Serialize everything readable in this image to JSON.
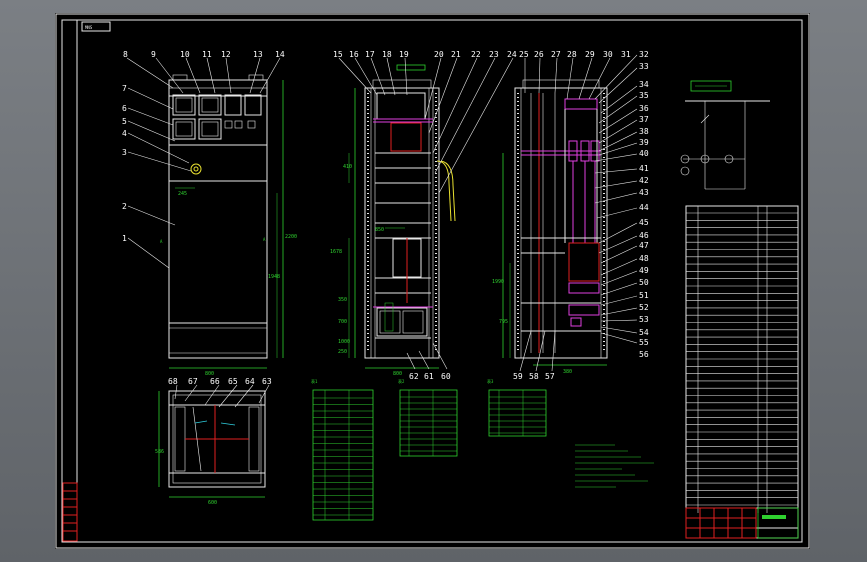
{
  "sheet": {
    "frame_tag": "MNS"
  },
  "callouts_front": [
    "8",
    "9",
    "10",
    "11",
    "12",
    "13",
    "14",
    "7",
    "6",
    "5",
    "4",
    "3",
    "2",
    "1"
  ],
  "callouts_side": [
    "15",
    "16",
    "17",
    "18",
    "19",
    "20",
    "21",
    "22",
    "23",
    "24"
  ],
  "callouts_rear": [
    "25",
    "26",
    "27",
    "28",
    "29",
    "30",
    "31",
    "32",
    "33",
    "34",
    "35",
    "36",
    "37",
    "38",
    "39",
    "40",
    "41",
    "42",
    "43",
    "44",
    "45",
    "46",
    "47",
    "48",
    "49",
    "50",
    "51",
    "52",
    "53",
    "54",
    "55",
    "56"
  ],
  "callouts_bottom_side": [
    "62",
    "61",
    "60"
  ],
  "callouts_bottom_rear": [
    "59",
    "58",
    "57"
  ],
  "callouts_plan": [
    "68",
    "67",
    "66",
    "65",
    "64",
    "63"
  ],
  "dimensions": {
    "front_width": "800",
    "front_height": "2200",
    "front_inner": "1948",
    "front_handle": "245",
    "side_width": "800",
    "side_top": "410",
    "side_mid": "1678",
    "side_a": "350",
    "side_b": "700",
    "side_c": "1000",
    "side_d": "850",
    "side_e": "250",
    "rear_width": "1990",
    "rear_h": "795",
    "rear_bottom": "380",
    "plan_depth": "586",
    "plan_width": "600"
  },
  "tables": {
    "t1_label": "表1",
    "t2_label": "表2",
    "t3_label": "表3"
  }
}
